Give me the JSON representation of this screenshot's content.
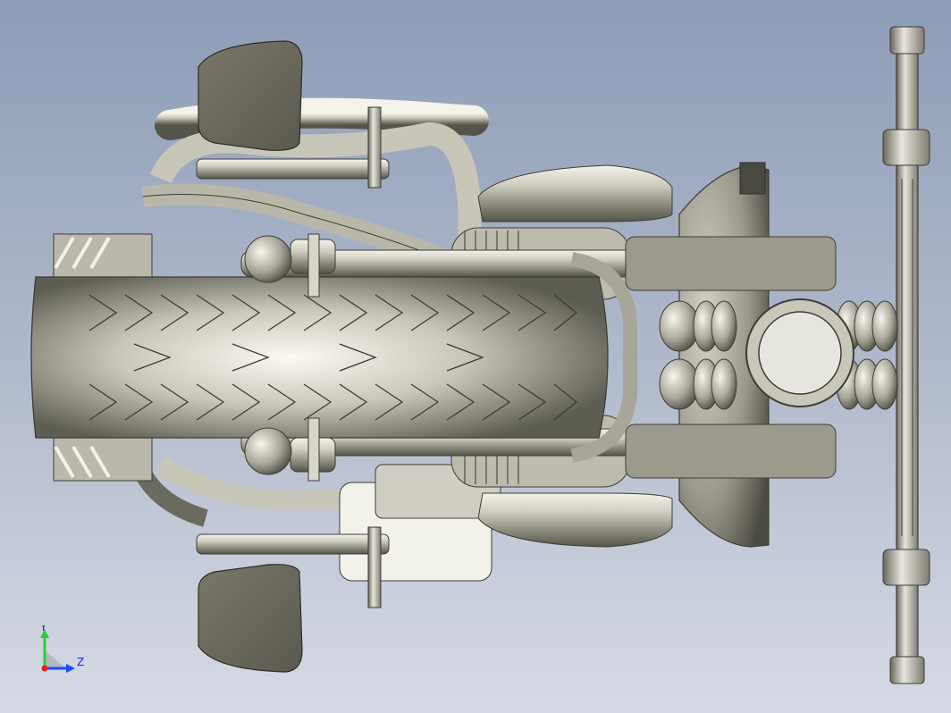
{
  "viewport": {
    "background_top": "#8d9cb7",
    "background_bottom": "#d6dae4"
  },
  "model": {
    "description_icon": "motorcycle-cad-model",
    "metal_color": "#c8c6b8",
    "dark_metal_color": "#6f6d62",
    "seat_color": "#6e6c5e"
  },
  "triad": {
    "y_label": "Y",
    "z_label": "Z",
    "y_color": "#2ecc40",
    "z_color": "#1a4dff",
    "origin_color": "#e02020"
  }
}
